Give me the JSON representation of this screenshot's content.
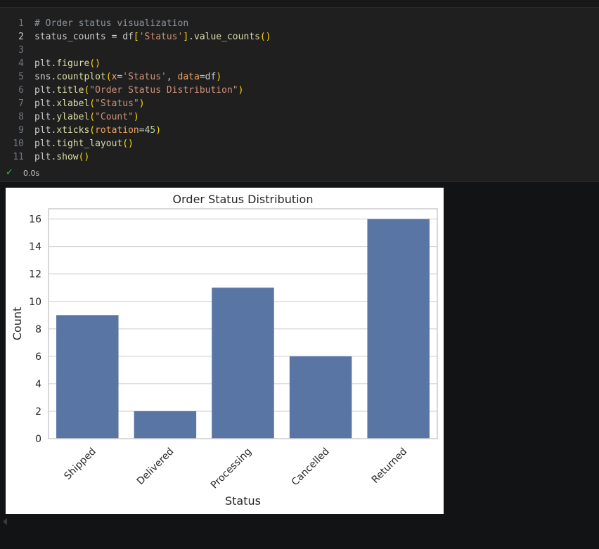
{
  "code_lines": [
    {
      "n": "1",
      "tokens": [
        {
          "t": "# Order status visualization",
          "c": "c-comment"
        }
      ]
    },
    {
      "n": "2",
      "tokens": [
        {
          "t": "status_counts = df",
          "c": "c-var"
        },
        {
          "t": "[",
          "c": "c-br"
        },
        {
          "t": "'Status'",
          "c": "c-str"
        },
        {
          "t": "]",
          "c": "c-br"
        },
        {
          "t": ".",
          "c": "c-var"
        },
        {
          "t": "value_counts",
          "c": "c-fn"
        },
        {
          "t": "()",
          "c": "c-br"
        }
      ]
    },
    {
      "n": "3",
      "tokens": []
    },
    {
      "n": "4",
      "tokens": [
        {
          "t": "plt.",
          "c": "c-var"
        },
        {
          "t": "figure",
          "c": "c-fn"
        },
        {
          "t": "()",
          "c": "c-br"
        }
      ]
    },
    {
      "n": "5",
      "tokens": [
        {
          "t": "sns.",
          "c": "c-var"
        },
        {
          "t": "countplot",
          "c": "c-fn"
        },
        {
          "t": "(",
          "c": "c-br"
        },
        {
          "t": "x",
          "c": "c-kwarg"
        },
        {
          "t": "=",
          "c": "c-var"
        },
        {
          "t": "'Status'",
          "c": "c-str"
        },
        {
          "t": ", ",
          "c": "c-var"
        },
        {
          "t": "data",
          "c": "c-kwarg"
        },
        {
          "t": "=df",
          "c": "c-var"
        },
        {
          "t": ")",
          "c": "c-br"
        }
      ]
    },
    {
      "n": "6",
      "tokens": [
        {
          "t": "plt.",
          "c": "c-var"
        },
        {
          "t": "title",
          "c": "c-fn"
        },
        {
          "t": "(",
          "c": "c-br"
        },
        {
          "t": "\"Order Status Distribution\"",
          "c": "c-str"
        },
        {
          "t": ")",
          "c": "c-br"
        }
      ]
    },
    {
      "n": "7",
      "tokens": [
        {
          "t": "plt.",
          "c": "c-var"
        },
        {
          "t": "xlabel",
          "c": "c-fn"
        },
        {
          "t": "(",
          "c": "c-br"
        },
        {
          "t": "\"Status\"",
          "c": "c-str"
        },
        {
          "t": ")",
          "c": "c-br"
        }
      ]
    },
    {
      "n": "8",
      "tokens": [
        {
          "t": "plt.",
          "c": "c-var"
        },
        {
          "t": "ylabel",
          "c": "c-fn"
        },
        {
          "t": "(",
          "c": "c-br"
        },
        {
          "t": "\"Count\"",
          "c": "c-str"
        },
        {
          "t": ")",
          "c": "c-br"
        }
      ]
    },
    {
      "n": "9",
      "tokens": [
        {
          "t": "plt.",
          "c": "c-var"
        },
        {
          "t": "xticks",
          "c": "c-fn"
        },
        {
          "t": "(",
          "c": "c-br"
        },
        {
          "t": "rotation",
          "c": "c-kwarg"
        },
        {
          "t": "=",
          "c": "c-var"
        },
        {
          "t": "45",
          "c": "c-num"
        },
        {
          "t": ")",
          "c": "c-br"
        }
      ]
    },
    {
      "n": "10",
      "tokens": [
        {
          "t": "plt.",
          "c": "c-var"
        },
        {
          "t": "tight_layout",
          "c": "c-fn"
        },
        {
          "t": "()",
          "c": "c-br"
        }
      ]
    },
    {
      "n": "11",
      "tokens": [
        {
          "t": "plt.",
          "c": "c-var"
        },
        {
          "t": "show",
          "c": "c-fn"
        },
        {
          "t": "()",
          "c": "c-br"
        }
      ]
    }
  ],
  "active_line": "2",
  "execution": {
    "status_icon": "check-icon",
    "time": "0.0s"
  },
  "chart_data": {
    "type": "bar",
    "title": "Order Status Distribution",
    "xlabel": "Status",
    "ylabel": "Count",
    "categories": [
      "Shipped",
      "Delivered",
      "Processing",
      "Cancelled",
      "Returned"
    ],
    "values": [
      9,
      2,
      11,
      6,
      16
    ],
    "ylim": [
      0,
      16.75
    ],
    "yticks": [
      0,
      2,
      4,
      6,
      8,
      10,
      12,
      14,
      16
    ],
    "xtick_rotation": 45,
    "grid": true,
    "bar_color": "#5975a4"
  }
}
